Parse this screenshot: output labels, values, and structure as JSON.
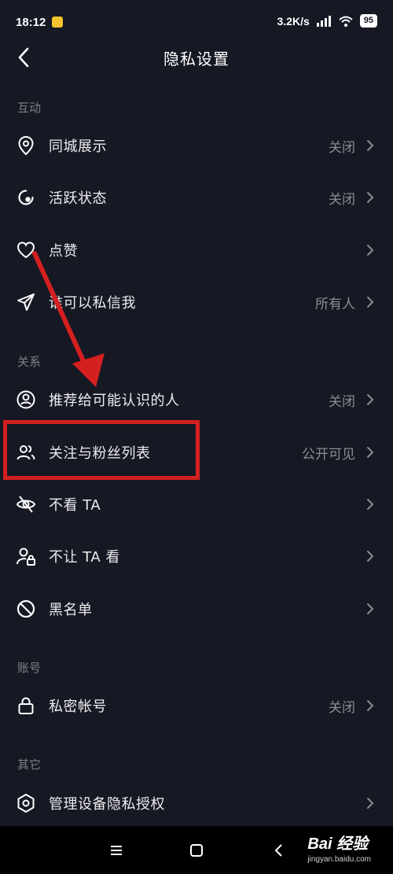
{
  "status": {
    "time": "18:12",
    "speed": "3.2K/s",
    "battery": "95"
  },
  "header": {
    "title": "隐私设置"
  },
  "sections": {
    "interaction": "互动",
    "relation": "关系",
    "account": "账号",
    "other": "其它"
  },
  "rows": {
    "same_city": {
      "label": "同城展示",
      "value": "关闭",
      "icon": "location-pin-icon"
    },
    "active_status": {
      "label": "活跃状态",
      "value": "关闭",
      "icon": "active-status-icon"
    },
    "likes": {
      "label": "点赞",
      "value": "",
      "icon": "heart-icon"
    },
    "who_can_dm": {
      "label": "谁可以私信我",
      "value": "所有人",
      "icon": "paper-plane-icon"
    },
    "recommend": {
      "label": "推荐给可能认识的人",
      "value": "关闭",
      "icon": "user-circle-icon"
    },
    "follow_list": {
      "label": "关注与粉丝列表",
      "value": "公开可见",
      "icon": "users-icon"
    },
    "not_see": {
      "label": "不看 TA",
      "value": "",
      "icon": "eye-off-icon"
    },
    "not_let_see": {
      "label": "不让 TA 看",
      "value": "",
      "icon": "user-lock-icon"
    },
    "blacklist": {
      "label": "黑名单",
      "value": "",
      "icon": "block-icon"
    },
    "private_account": {
      "label": "私密帐号",
      "value": "关闭",
      "icon": "lock-icon"
    },
    "device_privacy": {
      "label": "管理设备隐私授权",
      "value": "",
      "icon": "hexagon-shield-icon"
    }
  },
  "watermark": {
    "logo": "Bai 经验",
    "site": "jingyan.baidu.com"
  },
  "colors": {
    "background": "#161823",
    "highlight": "#d42020",
    "muted": "#8a8b93"
  }
}
